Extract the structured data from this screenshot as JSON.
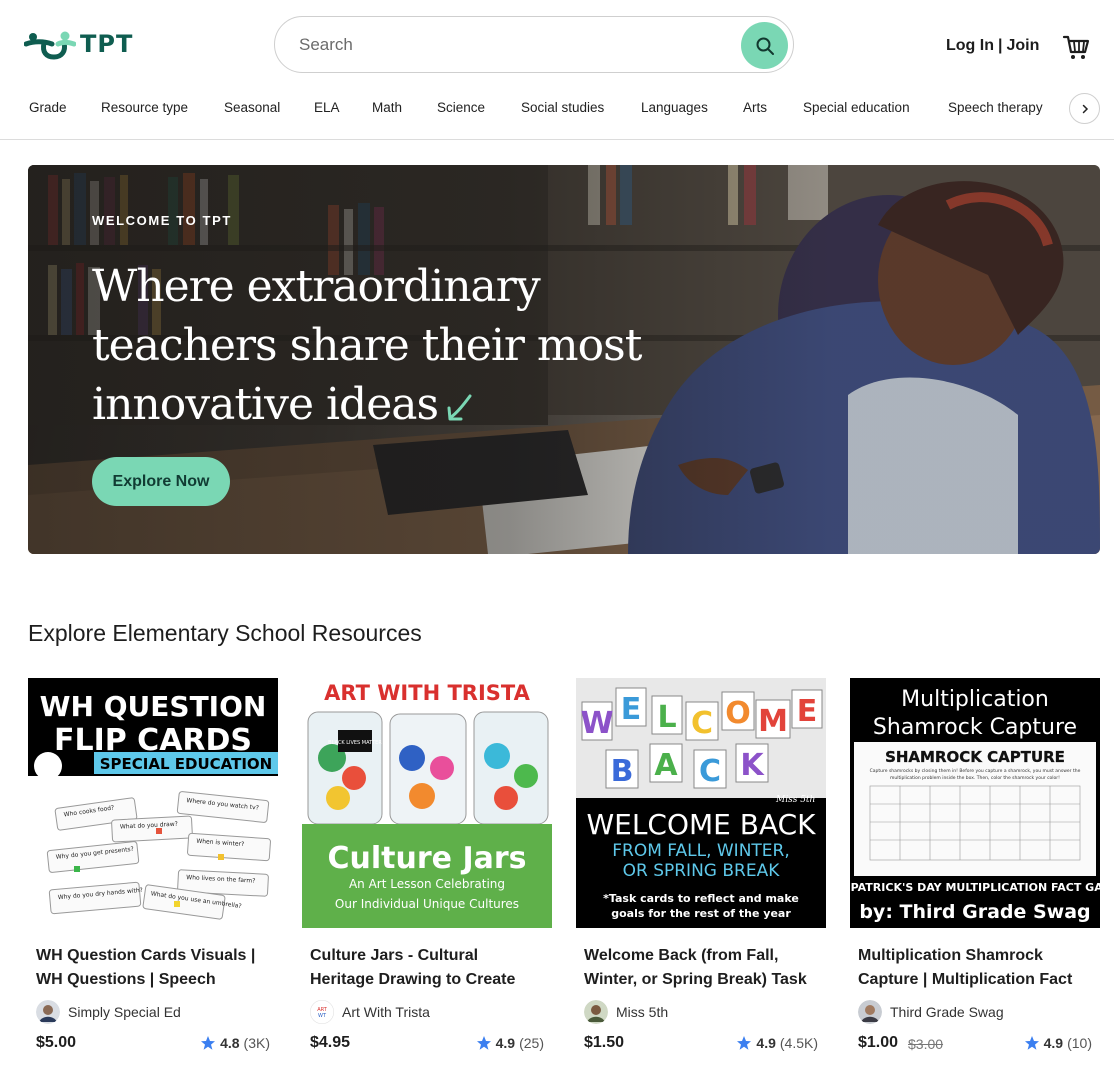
{
  "header": {
    "logo_text": "TPT",
    "search_placeholder": "Search",
    "login_label": "Log In",
    "divider": "|",
    "join_label": "Join"
  },
  "nav": {
    "items": [
      "Grade",
      "Resource type",
      "Seasonal",
      "ELA",
      "Math",
      "Science",
      "Social studies",
      "Languages",
      "Arts",
      "Special education",
      "Speech therapy"
    ]
  },
  "hero": {
    "eyebrow": "WELCOME TO TPT",
    "title": "Where extraordinary teachers share their most innovative ideas",
    "cta": "Explore Now"
  },
  "section": {
    "title": "Explore Elementary School Resources"
  },
  "products": [
    {
      "title": "WH Question Cards Visuals | WH Questions | Speech Therapy",
      "seller": "Simply Special Ed",
      "price": "$5.00",
      "old_price": "",
      "rating": "4.8",
      "rating_count": "(3K)",
      "thumb": {
        "line1": "WH QUESTION",
        "line2": "FLIP CARDS",
        "line3": "SPECIAL EDUCATION",
        "cards": [
          "Who cooks food?",
          "Where do you watch tv?",
          "What do you draw?",
          "When is winter?",
          "Why do you get presents?",
          "Who lives on the farm?",
          "Why do you dry hands with?",
          "What do you use an umbrella?"
        ]
      }
    },
    {
      "title": "Culture Jars - Cultural Heritage Drawing to Create Identity",
      "seller": "Art With Trista",
      "price": "$4.95",
      "old_price": "",
      "rating": "4.9",
      "rating_count": "(25)",
      "thumb": {
        "line1": "ART WITH TRISTA",
        "line2": "Culture Jars",
        "line3": "An Art Lesson Celebrating",
        "line4": "Our Individual Unique Cultures",
        "jar_text": "BLACK LIVES MATTER"
      }
    },
    {
      "title": "Welcome Back (from Fall, Winter, or Spring Break) Task Cards",
      "seller": "Miss 5th",
      "price": "$1.50",
      "old_price": "",
      "rating": "4.9",
      "rating_count": "(4.5K)",
      "thumb": {
        "letters1": [
          "W",
          "E",
          "L",
          "C",
          "O",
          "M",
          "E"
        ],
        "letters2": [
          "B",
          "A",
          "C",
          "K"
        ],
        "line1": "WELCOME BACK",
        "line2": "FROM FALL, WINTER,",
        "line3": "OR SPRING BREAK",
        "line4": "*Task cards to reflect and make",
        "line5": "goals for the rest of the year",
        "signature": "Miss 5th"
      }
    },
    {
      "title": "Multiplication Shamrock Capture | Multiplication Fact Game",
      "seller": "Third Grade Swag",
      "price": "$1.00",
      "old_price": "$3.00",
      "rating": "4.9",
      "rating_count": "(10)",
      "thumb": {
        "line1": "Multiplication",
        "line2": "Shamrock Capture",
        "sheet_title": "SHAMROCK CAPTURE",
        "sheet_text1": "Capture shamrocks by closing them in! Before you capture a shamrock, you must answer the",
        "sheet_text2": "multiplication problem inside the box. Then, color the shamrock your color!",
        "line3": "ST. PATRICK'S DAY MULTIPLICATION FACT GAME",
        "line4": "by: Third Grade Swag"
      }
    }
  ],
  "colors": {
    "brand": "#0f5d50",
    "accent": "#7ad7b4",
    "star": "#3b7ff0"
  }
}
